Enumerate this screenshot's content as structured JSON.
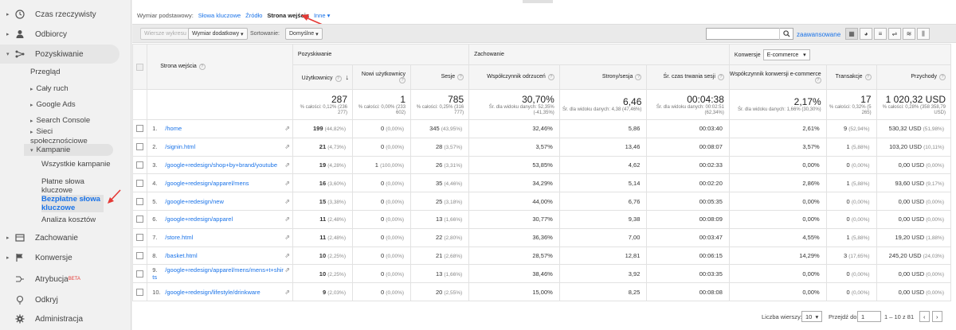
{
  "sidebar": {
    "items": [
      {
        "label": "Czas rzeczywisty",
        "icon": "clock-icon"
      },
      {
        "label": "Odbiorcy",
        "icon": "person-icon"
      },
      {
        "label": "Pozyskiwanie",
        "icon": "acquisition-icon"
      },
      {
        "label": "Zachowanie",
        "icon": "behavior-icon"
      },
      {
        "label": "Konwersje",
        "icon": "flag-icon"
      },
      {
        "label": "Atrybucja",
        "icon": "attribution-icon",
        "badge": "BETA"
      },
      {
        "label": "Odkryj",
        "icon": "lightbulb-icon"
      },
      {
        "label": "Administracja",
        "icon": "gear-icon"
      }
    ],
    "acq_sub": [
      "Przegląd",
      "Cały ruch",
      "Google Ads",
      "Search Console",
      "Sieci społecznościowe",
      "Kampanie"
    ],
    "campaign_sub": [
      "Wszystkie kampanie",
      "Płatne słowa kluczowe",
      "Bezpłatne słowa kluczowe",
      "Analiza kosztów"
    ]
  },
  "dimbar": {
    "label": "Wymiar podstawowy:",
    "options": [
      "Słowa kluczowe",
      "Źródło"
    ],
    "current": "Strona wejścia",
    "other": "Inne"
  },
  "toolbar": {
    "plot_rows": "Wiersze wykresu",
    "secondary_dim": "Wymiar dodatkowy",
    "sort_label": "Sortowanie:",
    "sort_value": "Domyślne",
    "search_placeholder": "",
    "advanced": "zaawansowane"
  },
  "table": {
    "groups": {
      "acq": "Pozyskiwanie",
      "beh": "Zachowanie",
      "conv": "Konwersje",
      "conv_value": "E-commerce"
    },
    "headers": {
      "page": "Strona wejścia",
      "users": "Użytkownicy",
      "new_users": "Nowi użytkownicy",
      "sessions": "Sesje",
      "bounce": "Współczynnik odrzuceń",
      "pages_session": "Strony/sesja",
      "avg_time": "Śr. czas trwania sesji",
      "conv_rate": "Współczynnik konwersji e-commerce",
      "transactions": "Transakcje",
      "revenue": "Przychody"
    },
    "totals": {
      "users": "287",
      "users_sub": "% całości: 0,12% (236 277)",
      "new_users": "1",
      "new_users_sub": "% całości: 0,00% (233 602)",
      "sessions": "785",
      "sessions_sub": "% całości: 0,25% (316 777)",
      "bounce": "30,70%",
      "bounce_sub": "Śr. dla widoku danych: 52,35% (-41,35%)",
      "pages_session": "6,46",
      "pages_session_sub": "Śr. dla widoku danych: 4,38 (47,46%)",
      "avg_time": "00:04:38",
      "avg_time_sub": "Śr. dla widoku danych: 00:02:51 (62,34%)",
      "conv_rate": "2,17%",
      "conv_rate_sub": "Śr. dla widoku danych: 1,66% (30,30%)",
      "transactions": "17",
      "transactions_sub": "% całości: 0,32% (5 265)",
      "revenue": "1 020,32 USD",
      "revenue_sub": "% całości: 0,28% (358 358,79 USD)"
    },
    "rows": [
      {
        "n": "1.",
        "page": "/home",
        "users": "199",
        "users_pc": "(44,82%)",
        "new": "0",
        "new_pc": "(0,00%)",
        "sessions": "345",
        "sessions_pc": "(43,95%)",
        "bounce": "32,46%",
        "pps": "5,86",
        "time": "00:03:40",
        "conv": "2,61%",
        "trans": "9",
        "trans_pc": "(52,94%)",
        "rev": "530,32 USD",
        "rev_pc": "(51,98%)"
      },
      {
        "n": "2.",
        "page": "/signin.html",
        "users": "21",
        "users_pc": "(4,73%)",
        "new": "0",
        "new_pc": "(0,00%)",
        "sessions": "28",
        "sessions_pc": "(3,57%)",
        "bounce": "3,57%",
        "pps": "13,46",
        "time": "00:08:07",
        "conv": "3,57%",
        "trans": "1",
        "trans_pc": "(5,88%)",
        "rev": "103,20 USD",
        "rev_pc": "(10,11%)"
      },
      {
        "n": "3.",
        "page": "/google+redesign/shop+by+brand/youtube",
        "users": "19",
        "users_pc": "(4,28%)",
        "new": "1",
        "new_pc": "(100,00%)",
        "sessions": "26",
        "sessions_pc": "(3,31%)",
        "bounce": "53,85%",
        "pps": "4,62",
        "time": "00:02:33",
        "conv": "0,00%",
        "trans": "0",
        "trans_pc": "(0,00%)",
        "rev": "0,00 USD",
        "rev_pc": "(0,00%)"
      },
      {
        "n": "4.",
        "page": "/google+redesign/apparel/mens",
        "users": "16",
        "users_pc": "(3,60%)",
        "new": "0",
        "new_pc": "(0,00%)",
        "sessions": "35",
        "sessions_pc": "(4,46%)",
        "bounce": "34,29%",
        "pps": "5,14",
        "time": "00:02:20",
        "conv": "2,86%",
        "trans": "1",
        "trans_pc": "(5,88%)",
        "rev": "93,60 USD",
        "rev_pc": "(9,17%)"
      },
      {
        "n": "5.",
        "page": "/google+redesign/new",
        "users": "15",
        "users_pc": "(3,38%)",
        "new": "0",
        "new_pc": "(0,00%)",
        "sessions": "25",
        "sessions_pc": "(3,18%)",
        "bounce": "44,00%",
        "pps": "6,76",
        "time": "00:05:35",
        "conv": "0,00%",
        "trans": "0",
        "trans_pc": "(0,00%)",
        "rev": "0,00 USD",
        "rev_pc": "(0,00%)"
      },
      {
        "n": "6.",
        "page": "/google+redesign/apparel",
        "users": "11",
        "users_pc": "(2,48%)",
        "new": "0",
        "new_pc": "(0,00%)",
        "sessions": "13",
        "sessions_pc": "(1,66%)",
        "bounce": "30,77%",
        "pps": "9,38",
        "time": "00:08:09",
        "conv": "0,00%",
        "trans": "0",
        "trans_pc": "(0,00%)",
        "rev": "0,00 USD",
        "rev_pc": "(0,00%)"
      },
      {
        "n": "7.",
        "page": "/store.html",
        "users": "11",
        "users_pc": "(2,48%)",
        "new": "0",
        "new_pc": "(0,00%)",
        "sessions": "22",
        "sessions_pc": "(2,80%)",
        "bounce": "36,36%",
        "pps": "7,00",
        "time": "00:03:47",
        "conv": "4,55%",
        "trans": "1",
        "trans_pc": "(5,88%)",
        "rev": "19,20 USD",
        "rev_pc": "(1,88%)"
      },
      {
        "n": "8.",
        "page": "/basket.html",
        "users": "10",
        "users_pc": "(2,25%)",
        "new": "0",
        "new_pc": "(0,00%)",
        "sessions": "21",
        "sessions_pc": "(2,68%)",
        "bounce": "28,57%",
        "pps": "12,81",
        "time": "00:06:15",
        "conv": "14,29%",
        "trans": "3",
        "trans_pc": "(17,65%)",
        "rev": "245,20 USD",
        "rev_pc": "(24,03%)"
      },
      {
        "n": "9.",
        "page": "/google+redesign/apparel/mens/mens+t+shirts",
        "users": "10",
        "users_pc": "(2,25%)",
        "new": "0",
        "new_pc": "(0,00%)",
        "sessions": "13",
        "sessions_pc": "(1,66%)",
        "bounce": "38,46%",
        "pps": "3,92",
        "time": "00:03:35",
        "conv": "0,00%",
        "trans": "0",
        "trans_pc": "(0,00%)",
        "rev": "0,00 USD",
        "rev_pc": "(0,00%)"
      },
      {
        "n": "10.",
        "page": "/google+redesign/lifestyle/drinkware",
        "users": "9",
        "users_pc": "(2,03%)",
        "new": "0",
        "new_pc": "(0,00%)",
        "sessions": "20",
        "sessions_pc": "(2,55%)",
        "bounce": "15,00%",
        "pps": "8,25",
        "time": "00:08:08",
        "conv": "0,00%",
        "trans": "0",
        "trans_pc": "(0,00%)",
        "rev": "0,00 USD",
        "rev_pc": "(0,00%)"
      }
    ]
  },
  "footer": {
    "rows_label": "Liczba wierszy:",
    "rows_value": "10",
    "goto_label": "Przejdź do:",
    "goto_value": "1",
    "range": "1 – 10 z 81"
  },
  "colors": {
    "accent": "#1a73e8",
    "annotation": "#e53935"
  }
}
